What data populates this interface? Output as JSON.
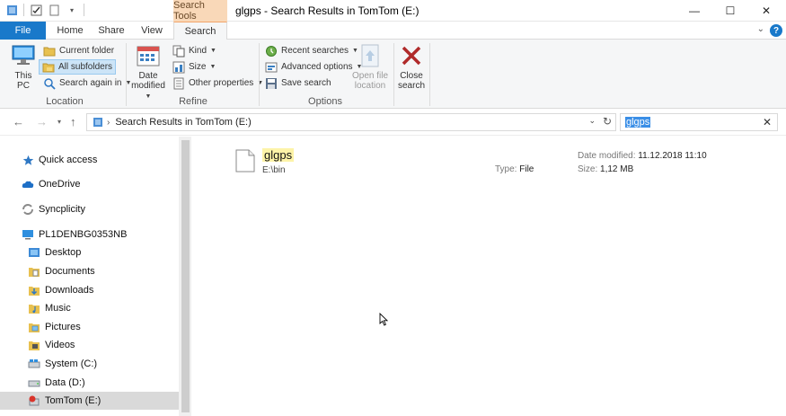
{
  "window": {
    "title": "glgps - Search Results in TomTom (E:)",
    "contextual_tab": "Search Tools"
  },
  "tabs": [
    "File",
    "Home",
    "Share",
    "View",
    "Search"
  ],
  "ribbon": {
    "location": {
      "label": "Location",
      "this_pc_line1": "This",
      "this_pc_line2": "PC",
      "current_folder": "Current folder",
      "all_subfolders": "All subfolders",
      "search_again_in": "Search again in"
    },
    "refine": {
      "label": "Refine",
      "date_modified_line1": "Date",
      "date_modified_line2": "modified",
      "kind": "Kind",
      "size": "Size",
      "other_properties": "Other properties"
    },
    "options": {
      "label": "Options",
      "recent_searches": "Recent searches",
      "advanced_options": "Advanced options",
      "save_search": "Save search",
      "open_file_location_line1": "Open file",
      "open_file_location_line2": "location"
    },
    "close": {
      "line1": "Close",
      "line2": "search"
    }
  },
  "address": {
    "path": "Search Results in TomTom (E:)",
    "search_value": "glgps"
  },
  "nav": {
    "items": [
      {
        "label": "Quick access",
        "icon": "star-icon"
      },
      {
        "label": "OneDrive",
        "icon": "cloud-icon"
      },
      {
        "label": "Syncplicity",
        "icon": "sync-icon"
      },
      {
        "label": "PL1DENBG0353NB",
        "icon": "computer-icon"
      },
      {
        "label": "Desktop",
        "icon": "desktop-folder-icon"
      },
      {
        "label": "Documents",
        "icon": "documents-folder-icon"
      },
      {
        "label": "Downloads",
        "icon": "downloads-folder-icon"
      },
      {
        "label": "Music",
        "icon": "music-folder-icon"
      },
      {
        "label": "Pictures",
        "icon": "pictures-folder-icon"
      },
      {
        "label": "Videos",
        "icon": "videos-folder-icon"
      },
      {
        "label": "System (C:)",
        "icon": "drive-icon"
      },
      {
        "label": "Data (D:)",
        "icon": "drive-icon"
      },
      {
        "label": "TomTom (E:)",
        "icon": "usb-drive-icon"
      }
    ]
  },
  "result": {
    "name": "glgps",
    "path": "E:\\bin",
    "type_label": "Type:",
    "type_value": "File",
    "date_label": "Date modified:",
    "date_value": "11.12.2018 11:10",
    "size_label": "Size:",
    "size_value": "1,12 MB"
  },
  "colors": {
    "accent": "#1979ca",
    "contextual_tab": "#f9d8b8",
    "search_highlight": "#fdf3a8",
    "close_search_x": "#b02a2a"
  }
}
